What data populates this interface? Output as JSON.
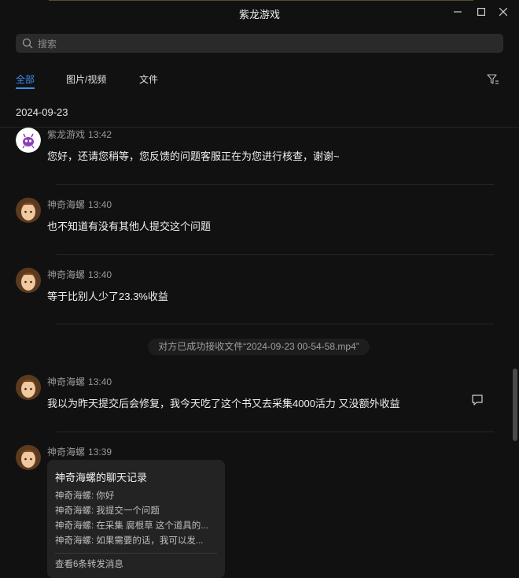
{
  "window": {
    "title": "紫龙游戏"
  },
  "search": {
    "placeholder": "搜索"
  },
  "tabs": [
    {
      "label": "全部",
      "active": true
    },
    {
      "label": "图片/视频",
      "active": false
    },
    {
      "label": "文件",
      "active": false
    }
  ],
  "date_header": "2024-09-23",
  "messages": [
    {
      "sender": "紫龙游戏",
      "time": "13:42",
      "text": "您好，还请您稍等，您反馈的问题客服正在为您进行核查，谢谢~"
    },
    {
      "sender": "神奇海螺",
      "time": "13:40",
      "text": "也不知道有没有其他人提交这个问题"
    },
    {
      "sender": "神奇海螺",
      "time": "13:40",
      "text": "等于比别人少了23.3%收益"
    },
    {
      "sender": "神奇海螺",
      "time": "13:40",
      "text": "我以为昨天提交后会修复，我今天吃了这个书又去采集4000活力 又没额外收益"
    },
    {
      "sender": "神奇海螺",
      "time": "13:39"
    }
  ],
  "system_note": "对方已成功接收文件“2024-09-23 00-54-58.mp4”",
  "chat_record": {
    "title": "神奇海螺的聊天记录",
    "lines": [
      "神奇海螺: 你好",
      "神奇海螺: 我提交一个问题",
      "神奇海螺: 在采集 腐根草 这个道具的...",
      "神奇海螺: 如果需要的话，我可以发..."
    ],
    "footer": "查看6条转发消息"
  },
  "colors": {
    "background": "#111111",
    "accent": "#3b8ff0",
    "search_bg": "#2a2a2a"
  }
}
